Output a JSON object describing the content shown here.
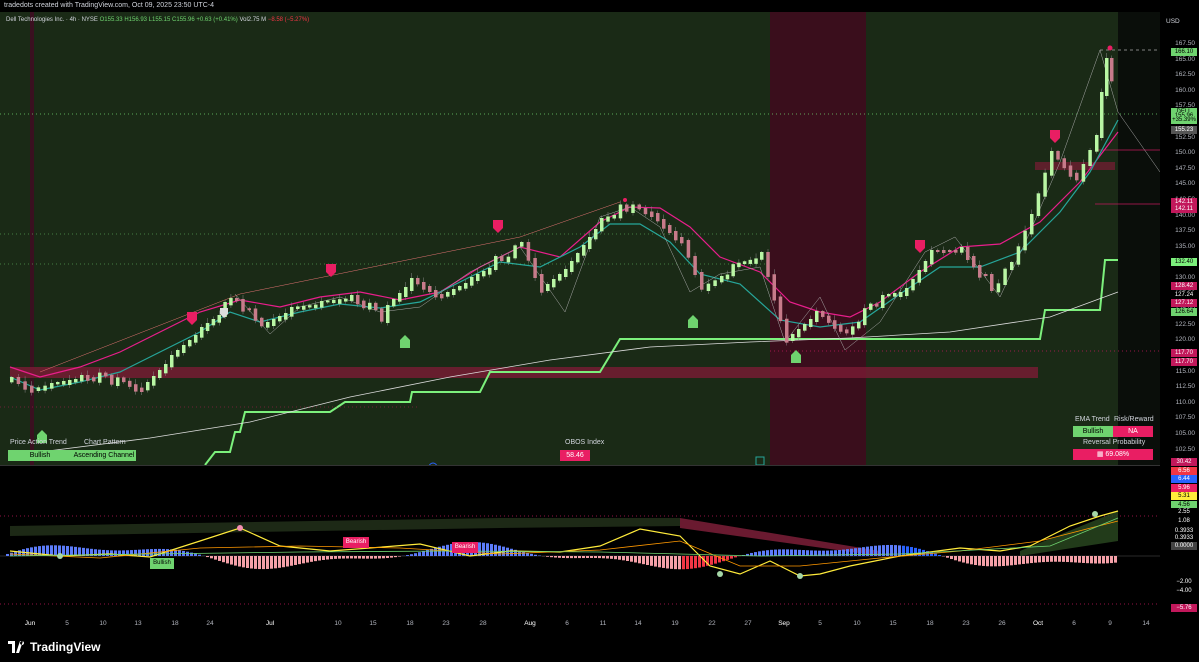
{
  "topbar": {
    "text": "tradedots created with TradingView.com, Oct 09, 2025 23:50 UTC-4"
  },
  "symbol_line": {
    "name": "Dell Technologies Inc. · 4h · NYSE",
    "open": "O155.33",
    "high": "H156.93",
    "low": "L155.15",
    "close": "C155.96",
    "change": "+0.63 (+0.41%)",
    "vol": "Vol2.75 M",
    "vol_change": "−8.58 (−5.27%)"
  },
  "currency": "USD",
  "price_ticks": [
    "167.50",
    "165.00",
    "162.50",
    "160.00",
    "157.50",
    "155.00",
    "152.50",
    "150.00",
    "147.50",
    "145.00",
    "142.50",
    "140.00",
    "137.50",
    "135.00",
    "132.50",
    "130.00",
    "127.50",
    "125.00",
    "122.50",
    "120.00",
    "117.50",
    "115.00",
    "112.50",
    "110.00",
    "107.50",
    "105.00",
    "102.50"
  ],
  "price_tags": [
    {
      "text": "166.10",
      "color": "#6fd36f",
      "fg": "#000"
    },
    {
      "text": "DELL",
      "color": "#6fd36f",
      "fg": "#000"
    },
    {
      "text": "155.96",
      "color": "#6fd36f",
      "fg": "#000"
    },
    {
      "text": "+35.39%",
      "color": "#6fd36f",
      "fg": "#000"
    },
    {
      "text": "155.23",
      "color": "#555",
      "fg": "#fff"
    },
    {
      "text": "142.11",
      "color": "#c2185b",
      "fg": "#fff"
    },
    {
      "text": "142.11",
      "color": "#c2185b",
      "fg": "#fff"
    },
    {
      "text": "132.40",
      "color": "#7cf07c",
      "fg": "#000"
    },
    {
      "text": "128.42",
      "color": "#c2185b",
      "fg": "#fff"
    },
    {
      "text": "127.24",
      "color": "#000",
      "fg": "#fff"
    },
    {
      "text": "127.12",
      "color": "#c2185b",
      "fg": "#fff"
    },
    {
      "text": "126.64",
      "color": "#6fd36f",
      "fg": "#000"
    },
    {
      "text": "117.70",
      "color": "#c2185b",
      "fg": "#fff"
    },
    {
      "text": "117.70",
      "color": "#c2185b",
      "fg": "#fff"
    }
  ],
  "osc_tags": [
    {
      "text": "30.42",
      "color": "#c2185b",
      "fg": "#fff"
    },
    {
      "text": "6.56",
      "color": "#f23645",
      "fg": "#fff"
    },
    {
      "text": "6.44",
      "color": "#2962ff",
      "fg": "#fff"
    },
    {
      "text": "5.96",
      "color": "#e91e63",
      "fg": "#fff"
    },
    {
      "text": "5.31",
      "color": "#ffeb3b",
      "fg": "#000"
    },
    {
      "text": "4.56",
      "color": "#6fd36f",
      "fg": "#000"
    },
    {
      "text": "2.55",
      "color": "#000",
      "fg": "#fff"
    },
    {
      "text": "1.08",
      "color": "#000",
      "fg": "#fff"
    },
    {
      "text": "0.3933",
      "color": "#000",
      "fg": "#fff"
    },
    {
      "text": "0.3933",
      "color": "#000",
      "fg": "#fff"
    },
    {
      "text": "0.0000",
      "color": "#444",
      "fg": "#fff"
    },
    {
      "text": "−2.00",
      "color": "#000",
      "fg": "#fff"
    },
    {
      "text": "−4.00",
      "color": "#000",
      "fg": "#fff"
    },
    {
      "text": "−5.76",
      "color": "#c2185b",
      "fg": "#fff"
    }
  ],
  "time_ticks": [
    "Jun",
    "5",
    "10",
    "13",
    "18",
    "24",
    "Jul",
    "10",
    "15",
    "18",
    "23",
    "28",
    "Aug",
    "6",
    "11",
    "14",
    "19",
    "22",
    "27",
    "Sep",
    "5",
    "10",
    "15",
    "18",
    "23",
    "26",
    "Oct",
    "6",
    "9",
    "14"
  ],
  "panels": {
    "price_action_title": "Price Action Trend",
    "price_action_value": "Bullish",
    "chart_pattern_title": "Chart Pattern",
    "chart_pattern_value": "Ascending Channel",
    "obos_title": "OBOS Index",
    "obos_value": "58.46",
    "ema_title": "EMA Trend",
    "ema_value": "Bullish",
    "rr_title": "Risk/Reward",
    "rr_value": "NA",
    "rev_title": "Reversal Probability",
    "rev_value": "69.08%"
  },
  "osc_labels": {
    "bullish": "Bullish",
    "bearish1": "Bearish",
    "bearish2": "Bearish"
  },
  "footer": {
    "brand": "TradingView"
  },
  "colors": {
    "bull": "#6fd36f",
    "bear": "#f23645",
    "magenta": "#e91e8c",
    "teal": "#26a69a",
    "zone": "#c2185b"
  }
}
